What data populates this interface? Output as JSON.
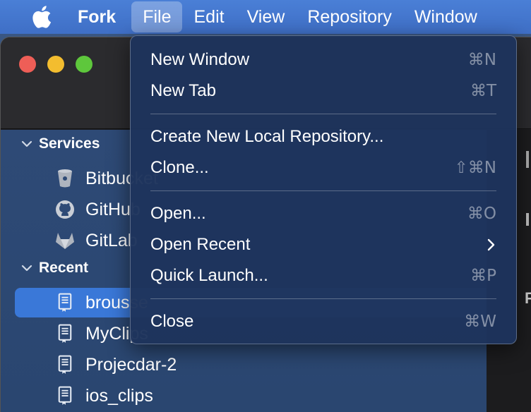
{
  "menubar": {
    "app_name": "Fork",
    "items": [
      "File",
      "Edit",
      "View",
      "Repository",
      "Window"
    ]
  },
  "sidebar": {
    "services_title": "Services",
    "services": [
      {
        "label": "Bitbucket",
        "icon": "bitbucket-icon"
      },
      {
        "label": "GitHub",
        "icon": "github-icon"
      },
      {
        "label": "GitLab",
        "icon": "gitlab-icon"
      }
    ],
    "recent_title": "Recent",
    "recent": [
      {
        "label": "brousse",
        "icon": "repository-icon"
      },
      {
        "label": "MyClips",
        "icon": "repository-icon"
      },
      {
        "label": "Projecdar-2",
        "icon": "repository-icon"
      },
      {
        "label": "ios_clips",
        "icon": "repository-icon"
      }
    ]
  },
  "right_pane": {
    "letter": "F"
  },
  "file_menu": {
    "groups": [
      [
        {
          "label": "New Window",
          "shortcut": "⌘N"
        },
        {
          "label": "New Tab",
          "shortcut": "⌘T"
        }
      ],
      [
        {
          "label": "Create New Local Repository...",
          "shortcut": ""
        },
        {
          "label": "Clone...",
          "shortcut": "⇧⌘N"
        }
      ],
      [
        {
          "label": "Open...",
          "shortcut": "⌘O"
        },
        {
          "label": "Open Recent",
          "shortcut": "",
          "submenu": true
        },
        {
          "label": "Quick Launch...",
          "shortcut": "⌘P"
        }
      ],
      [
        {
          "label": "Close",
          "shortcut": "⌘W"
        }
      ]
    ]
  },
  "colors": {
    "menubar": "#4378d0",
    "selection": "#3a78d8",
    "traffic_red": "#ee5e57",
    "traffic_yellow": "#f3bd2f",
    "traffic_green": "#5ec73c"
  }
}
